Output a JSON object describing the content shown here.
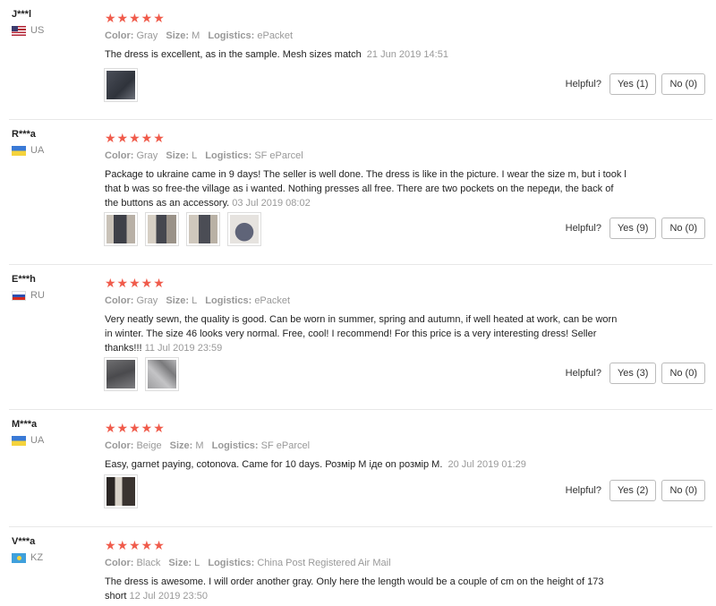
{
  "helpful_label": "Helpful?",
  "labels": {
    "color": "Color:",
    "size": "Size:",
    "logistics": "Logistics:"
  },
  "colors": {
    "star": "#f05b4b",
    "divider": "#e8e8e8"
  },
  "reviews": [
    {
      "user": "J***l",
      "country": "US",
      "flag": "us-flag",
      "stars": "★★★★★",
      "color": "Gray",
      "size": "M",
      "logistics": "ePacket",
      "text": "The dress is excellent, as in the sample. Mesh sizes match",
      "date": "21 Jun 2019 14:51",
      "yes": "Yes (1)",
      "no": "No (0)"
    },
    {
      "user": "R***a",
      "country": "UA",
      "flag": "ua-flag",
      "stars": "★★★★★",
      "color": "Gray",
      "size": "L",
      "logistics": "SF eParcel",
      "text_lines": [
        "Package to ukraine came in 9 days! The seller is well done. The dress is like in the picture. I wear the size m, but i took l",
        "that b was so free-the village as i wanted. Nothing presses all free. There are two pockets on the переди, the back of",
        "the buttons as an accessory."
      ],
      "date": "03 Jul 2019 08:02",
      "yes": "Yes (9)",
      "no": "No (0)"
    },
    {
      "user": "E***h",
      "country": "RU",
      "flag": "ru-flag",
      "stars": "★★★★★",
      "color": "Gray",
      "size": "L",
      "logistics": "ePacket",
      "text_lines": [
        "Very neatly sewn, the quality is good. Can be worn in summer, spring and autumn, if well heated at work, can be worn",
        "in winter. The size 46 looks very normal. Free, cool! I recommend! For this price is a very interesting dress! Seller",
        "thanks!!!"
      ],
      "date": "11 Jul 2019 23:59",
      "yes": "Yes (3)",
      "no": "No (0)"
    },
    {
      "user": "M***a",
      "country": "UA",
      "flag": "ua-flag",
      "stars": "★★★★★",
      "color": "Beige",
      "size": "M",
      "logistics": "SF eParcel",
      "text": "Easy, garnet paying, cotonova. Came for 10 days. Розмір М іде on розмір М.",
      "date": "20 Jul 2019 01:29",
      "yes": "Yes (2)",
      "no": "No (0)"
    },
    {
      "user": "V***a",
      "country": "KZ",
      "flag": "kz-flag",
      "stars": "★★★★★",
      "color": "Black",
      "size": "L",
      "logistics": "China Post Registered Air Mail",
      "text_lines": [
        "The dress is awesome. I will order another gray. Only here the length would be a couple of cm on the height of 173",
        "short"
      ],
      "date": "12 Jul 2019 23:50"
    }
  ]
}
